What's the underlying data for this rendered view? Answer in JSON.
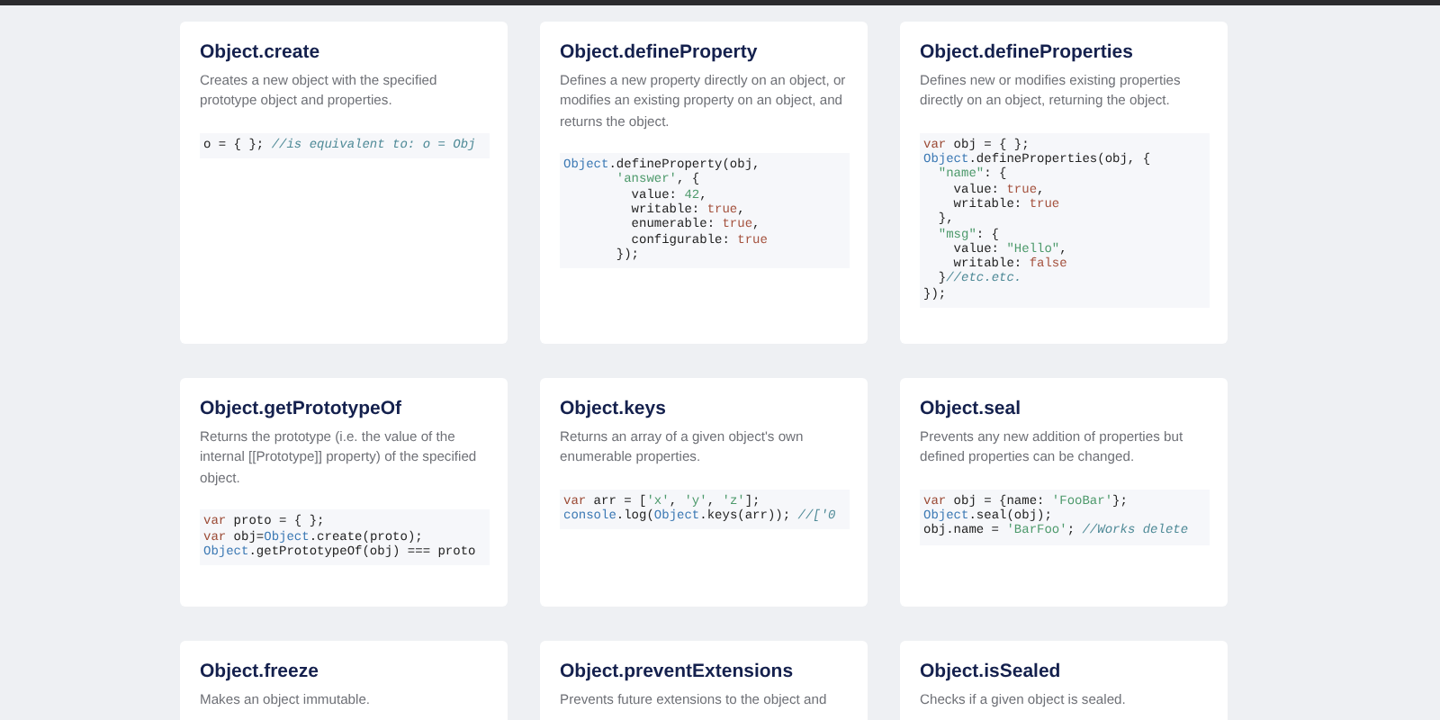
{
  "cards": [
    {
      "title": "Object.create",
      "description": "Creates a new object with the specified prototype object and properties.",
      "code": [
        [
          {
            "kind": "p",
            "text": "o = { }; "
          },
          {
            "kind": "cm",
            "text": "//is equivalent to: o = Obj"
          }
        ]
      ]
    },
    {
      "title": "Object.defineProperty",
      "description": "Defines a new property directly on an object, or modifies an existing property on an object, and returns the object.",
      "code": [
        [
          {
            "kind": "obj",
            "text": "Object"
          },
          {
            "kind": "p",
            "text": ".defineProperty(obj,"
          }
        ],
        [
          {
            "kind": "str",
            "text": "       'answer'"
          },
          {
            "kind": "p",
            "text": ", {"
          }
        ],
        [
          {
            "kind": "p",
            "text": "         value: "
          },
          {
            "kind": "num",
            "text": "42"
          },
          {
            "kind": "p",
            "text": ","
          }
        ],
        [
          {
            "kind": "p",
            "text": "         writable: "
          },
          {
            "kind": "bool",
            "text": "true"
          },
          {
            "kind": "p",
            "text": ","
          }
        ],
        [
          {
            "kind": "p",
            "text": "         enumerable: "
          },
          {
            "kind": "bool",
            "text": "true"
          },
          {
            "kind": "p",
            "text": ","
          }
        ],
        [
          {
            "kind": "p",
            "text": "         configurable: "
          },
          {
            "kind": "bool",
            "text": "true"
          }
        ],
        [
          {
            "kind": "p",
            "text": "       });"
          }
        ]
      ]
    },
    {
      "title": "Object.defineProperties",
      "description": "Defines new or modifies existing properties directly on an object, returning the object.",
      "code": [
        [
          {
            "kind": "kw",
            "text": "var"
          },
          {
            "kind": "p",
            "text": " obj = { };"
          }
        ],
        [
          {
            "kind": "obj",
            "text": "Object"
          },
          {
            "kind": "p",
            "text": ".defineProperties(obj, {"
          }
        ],
        [
          {
            "kind": "str",
            "text": "  \"name\""
          },
          {
            "kind": "p",
            "text": ": {"
          }
        ],
        [
          {
            "kind": "p",
            "text": "    value: "
          },
          {
            "kind": "bool",
            "text": "true"
          },
          {
            "kind": "p",
            "text": ","
          }
        ],
        [
          {
            "kind": "p",
            "text": "    writable: "
          },
          {
            "kind": "bool",
            "text": "true"
          }
        ],
        [
          {
            "kind": "p",
            "text": "  },"
          }
        ],
        [
          {
            "kind": "str",
            "text": "  \"msg\""
          },
          {
            "kind": "p",
            "text": ": {"
          }
        ],
        [
          {
            "kind": "p",
            "text": "    value: "
          },
          {
            "kind": "str",
            "text": "\"Hello\""
          },
          {
            "kind": "p",
            "text": ","
          }
        ],
        [
          {
            "kind": "p",
            "text": "    writable: "
          },
          {
            "kind": "bool",
            "text": "false"
          }
        ],
        [
          {
            "kind": "p",
            "text": "  }"
          },
          {
            "kind": "cm",
            "text": "//etc.etc."
          }
        ],
        [
          {
            "kind": "p",
            "text": "});"
          }
        ]
      ]
    },
    {
      "title": "Object.getPrototypeOf",
      "description": "Returns the prototype (i.e. the value of the internal [[Prototype]] property) of the specified object.",
      "code": [
        [
          {
            "kind": "kw",
            "text": "var"
          },
          {
            "kind": "p",
            "text": " proto = { };"
          }
        ],
        [
          {
            "kind": "kw",
            "text": "var"
          },
          {
            "kind": "p",
            "text": " obj="
          },
          {
            "kind": "obj",
            "text": "Object"
          },
          {
            "kind": "p",
            "text": ".create(proto);"
          }
        ],
        [
          {
            "kind": "obj",
            "text": "Object"
          },
          {
            "kind": "p",
            "text": ".getPrototypeOf(obj) === proto"
          }
        ]
      ]
    },
    {
      "title": "Object.keys",
      "description": "Returns an array of a given object's own enumerable properties.",
      "code": [
        [
          {
            "kind": "kw",
            "text": "var"
          },
          {
            "kind": "p",
            "text": " arr = ["
          },
          {
            "kind": "str",
            "text": "'x'"
          },
          {
            "kind": "p",
            "text": ", "
          },
          {
            "kind": "str",
            "text": "'y'"
          },
          {
            "kind": "p",
            "text": ", "
          },
          {
            "kind": "str",
            "text": "'z'"
          },
          {
            "kind": "p",
            "text": "];"
          }
        ],
        [
          {
            "kind": "obj",
            "text": "console"
          },
          {
            "kind": "p",
            "text": ".log("
          },
          {
            "kind": "obj",
            "text": "Object"
          },
          {
            "kind": "p",
            "text": ".keys(arr)); "
          },
          {
            "kind": "cm",
            "text": "//['0"
          }
        ]
      ]
    },
    {
      "title": "Object.seal",
      "description": "Prevents any new addition of properties but defined properties can be changed.",
      "code": [
        [
          {
            "kind": "kw",
            "text": "var"
          },
          {
            "kind": "p",
            "text": " obj = {name: "
          },
          {
            "kind": "str",
            "text": "'FooBar'"
          },
          {
            "kind": "p",
            "text": "};"
          }
        ],
        [
          {
            "kind": "obj",
            "text": "Object"
          },
          {
            "kind": "p",
            "text": ".seal(obj);"
          }
        ],
        [
          {
            "kind": "p",
            "text": "obj.name = "
          },
          {
            "kind": "str",
            "text": "'BarFoo'"
          },
          {
            "kind": "p",
            "text": "; "
          },
          {
            "kind": "cm",
            "text": "//Works delete"
          }
        ]
      ]
    },
    {
      "title": "Object.freeze",
      "description": "Makes an object immutable."
    },
    {
      "title": "Object.preventExtensions",
      "description": "Prevents future extensions to the object and"
    },
    {
      "title": "Object.isSealed",
      "description": "Checks if a given object is sealed."
    }
  ]
}
